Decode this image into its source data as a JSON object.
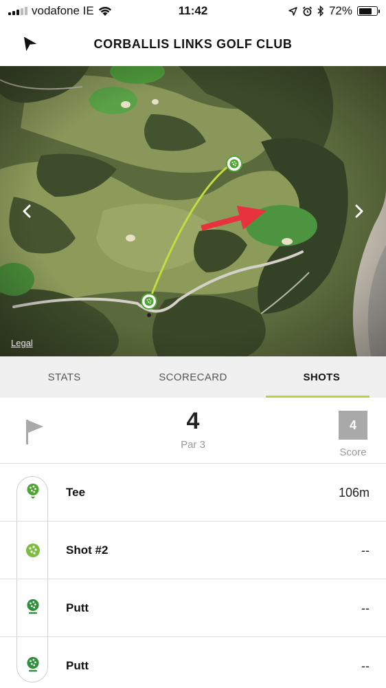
{
  "status_bar": {
    "carrier": "vodafone IE",
    "time": "11:42",
    "battery_text": "72%",
    "battery_level": 0.72
  },
  "header": {
    "title": "CORBALLIS LINKS GOLF CLUB",
    "back_icon": "back-arrow-icon"
  },
  "map": {
    "legal": "Legal",
    "shot_line_color": "#c4dc3c",
    "marker_color": "#4fa534",
    "annotation_arrow_color": "#e8333f"
  },
  "tabs": [
    {
      "label": "STATS",
      "active": false
    },
    {
      "label": "SCORECARD",
      "active": false
    },
    {
      "label": "SHOTS",
      "active": true
    }
  ],
  "hole": {
    "par_number": "4",
    "par_label": "Par 3",
    "score": "4",
    "score_label": "Score"
  },
  "shots": [
    {
      "name": "Tee",
      "distance": "106m"
    },
    {
      "name": "Shot #2",
      "distance": "--"
    },
    {
      "name": "Putt",
      "distance": "--"
    },
    {
      "name": "Putt",
      "distance": "--"
    }
  ],
  "colors": {
    "accent": "#b9d23a",
    "golf_green": "#4fa534",
    "score_box": "#a9a9a9"
  }
}
